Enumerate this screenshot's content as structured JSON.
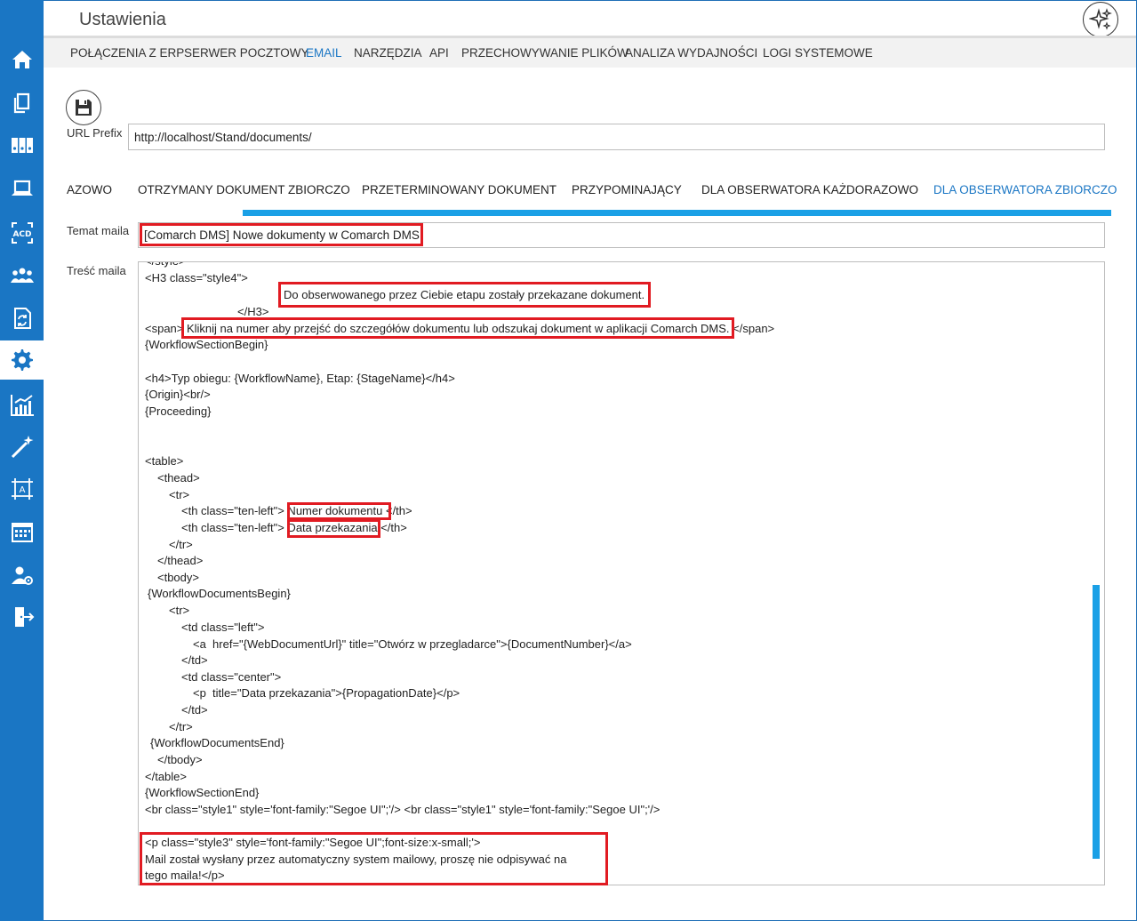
{
  "app": {
    "title": "Ustawienia"
  },
  "sidebar": {
    "items": [
      {
        "icon": "home-icon"
      },
      {
        "icon": "documents-icon"
      },
      {
        "icon": "binders-icon"
      },
      {
        "icon": "laptop-icon"
      },
      {
        "icon": "acd-icon",
        "label": "ACD"
      },
      {
        "icon": "users-icon"
      },
      {
        "icon": "workflow-document-icon"
      },
      {
        "icon": "gear-icon"
      },
      {
        "icon": "chart-icon"
      },
      {
        "icon": "magic-wand-icon"
      },
      {
        "icon": "layout-designer-icon",
        "label": "A"
      },
      {
        "icon": "calendar-icon"
      },
      {
        "icon": "user-settings-icon"
      },
      {
        "icon": "logout-icon"
      }
    ]
  },
  "topnav": {
    "items": [
      {
        "label": "POŁĄCZENIA Z ERP"
      },
      {
        "label": "SERWER POCZTOWY"
      },
      {
        "label": "EMAIL",
        "active": true
      },
      {
        "label": "NARZĘDZIA"
      },
      {
        "label": "API"
      },
      {
        "label": "PRZECHOWYWANIE PLIKÓW"
      },
      {
        "label": "ANALIZA WYDAJNOŚCI"
      },
      {
        "label": "LOGI SYSTEMOWE"
      }
    ]
  },
  "form": {
    "url_prefix_label": "URL Prefix",
    "url_prefix_value": "http://localhost/Stand/documents/",
    "subject_label": "Temat maila",
    "subject_value": "[Comarch DMS] Nowe dokumenty w Comarch DMS",
    "body_label": "Treść maila"
  },
  "subtabs": [
    {
      "label": "AZOWO"
    },
    {
      "label": "OTRZYMANY DOKUMENT ZBIORCZO"
    },
    {
      "label": "PRZETERMINOWANY DOKUMENT"
    },
    {
      "label": "PRZYPOMINAJĄCY"
    },
    {
      "label": "DLA OBSERWATORA KAŻDORAZOWO"
    },
    {
      "label": "DLA OBSERWATORA ZBIORCZO",
      "active": true
    }
  ],
  "editor": {
    "lines": [
      "</style>",
      "<H3 class=\"style4\">",
      "Do obserwowanego przez Ciebie etapu zostały przekazane dokument.",
      "</H3>",
      "<span> Kliknij na numer aby przejść do szczegółów dokumentu lub odszukaj dokument w aplikacji Comarch DMS. </span>",
      "{WorkflowSectionBegin}",
      "<h4>Typ obiegu: {WorkflowName}, Etap: {StageName}</h4>",
      "{Origin}<br/>",
      "{Proceeding}",
      "<table>",
      "<thead>",
      "<tr>",
      "<th class=\"ten-left\"> Numer dokumentu </th>",
      "<th class=\"ten-left\"> Data przekazania </th>",
      "</tr>",
      "</thead>",
      "<tbody>",
      "{WorkflowDocumentsBegin}",
      "<tr>",
      "<td class=\"left\">",
      "<a  href=\"{WebDocumentUrl}\" title=\"Otwórz w przegladarce\">{DocumentNumber}</a>",
      "</td>",
      "<td class=\"center\">",
      "<p  title=\"Data przekazania\">{PropagationDate}</p>",
      "</td>",
      "</tr>",
      "{WorkflowDocumentsEnd}",
      "</tbody>",
      "</table>",
      "{WorkflowSectionEnd}",
      "<br class=\"style1\" style='font-family:\"Segoe UI\";'/> <br class=\"style1\" style='font-family:\"Segoe UI\";'/>",
      "<p class=\"style3\" style='font-family:\"Segoe UI\";font-size:x-small;'>",
      "Mail został wysłany przez automatyczny system mailowy, proszę nie odpisywać na",
      "tego maila!</p>"
    ]
  },
  "colors": {
    "sidebar": "#1a76c4",
    "accent": "#1aa0e6",
    "highlight": "#e11b22"
  }
}
